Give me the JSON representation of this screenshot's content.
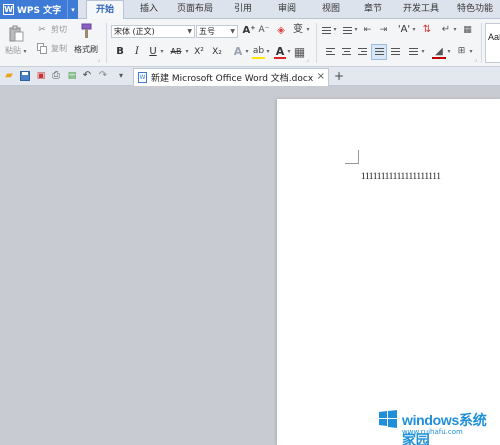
{
  "app": {
    "name": "WPS 文字",
    "logo_letter": "W",
    "drop_glyph": "▾"
  },
  "menu": {
    "tabs": [
      {
        "label": "开始",
        "active": true
      },
      {
        "label": "插入"
      },
      {
        "label": "页面布局"
      },
      {
        "label": "引用"
      },
      {
        "label": "审阅"
      },
      {
        "label": "视图"
      },
      {
        "label": "章节"
      },
      {
        "label": "开发工具"
      },
      {
        "label": "特色功能"
      }
    ]
  },
  "ribbon": {
    "paste_label": "粘贴",
    "cut_label": "剪切",
    "copy_label": "复制",
    "format_painter_label": "格式刷",
    "font_name": "宋体 (正文)",
    "font_size": "五号",
    "bold": "B",
    "italic": "I",
    "underline": "U",
    "strike": "AB",
    "superscript": "X²",
    "subscript": "X₂",
    "font_grow": "A⁺",
    "font_shrink": "A⁻",
    "phonetic": "变",
    "style_preview": "AaBb",
    "colors": {
      "highlight": "#ffe400",
      "font_color": "#e0242a",
      "shading": "#c00000"
    }
  },
  "document": {
    "tab_title": "新建 Microsoft Office Word 文档.docx",
    "close_glyph": "×",
    "new_tab_glyph": "+",
    "menu_glyph": "▾",
    "doc_icon_letter": "W",
    "content": "11111111111111111111"
  },
  "watermark": {
    "title": "windows系统家园",
    "url": "www.ruihafu.com"
  }
}
